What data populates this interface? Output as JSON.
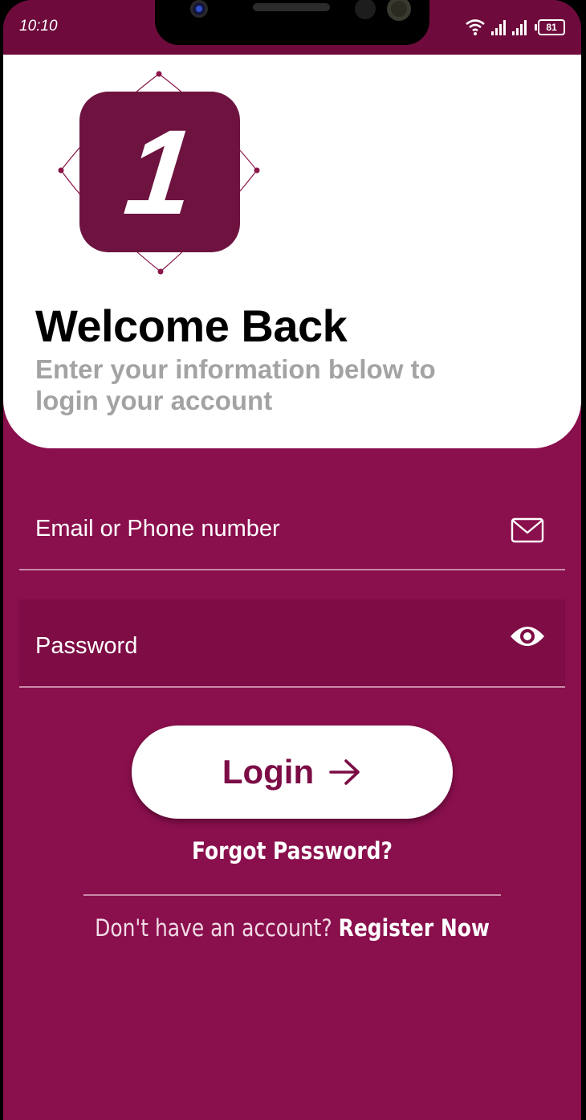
{
  "status_bar": {
    "time": "10:10",
    "battery": "81"
  },
  "logo": {
    "digit": "1"
  },
  "header": {
    "title": "Welcome Back",
    "subtitle": "Enter your information below to login your account"
  },
  "form": {
    "email_label": "Email or Phone number",
    "email_icon": "mail-icon",
    "password_label": "Password",
    "password_icon": "eye-icon"
  },
  "actions": {
    "login_label": "Login",
    "forgot_label": "Forgot Password?",
    "register_prompt": "Don't have an account?",
    "register_link": "Register Now"
  },
  "colors": {
    "primary": "#8a0f4d",
    "logo_bg": "#6e1340",
    "subtitle_gray": "#a3a3a3"
  }
}
